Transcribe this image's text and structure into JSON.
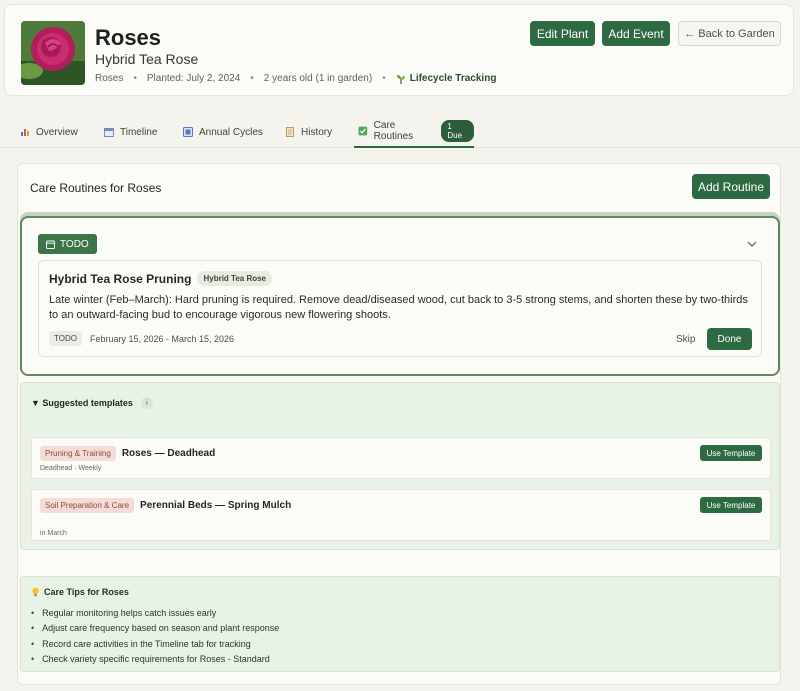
{
  "header": {
    "title": "Roses",
    "subtitle": "Hybrid Tea Rose",
    "meta": {
      "category": "Roses",
      "planted": "Planted: July 2, 2024",
      "age": "2 years old (1 in garden)",
      "lifecycle": "Lifecycle Tracking"
    },
    "buttons": {
      "edit": "Edit Plant",
      "add_event": "Add Event",
      "back": "← Back to Garden"
    }
  },
  "tabs": [
    {
      "label": "Overview",
      "icon": "bar-chart-icon"
    },
    {
      "label": "Timeline",
      "icon": "calendar-icon"
    },
    {
      "label": "Annual Cycles",
      "icon": "cycle-icon"
    },
    {
      "label": "History",
      "icon": "scroll-icon"
    },
    {
      "label": "Care Routines",
      "icon": "checkbox-icon",
      "badge": "1 Due",
      "active": true
    }
  ],
  "routines": {
    "title": "Care Routines for Roses",
    "add_button": "Add Routine",
    "group_label": "TODO",
    "item": {
      "name": "Hybrid Tea Rose Pruning",
      "variety": "Hybrid Tea Rose",
      "description": "Late winter (Feb–March): Hard pruning is required. Remove dead/diseased wood, cut back to 3-5 strong stems, and shorten these by two-thirds to an outward-facing bud to encourage vigorous new flowering shoots.",
      "status": "TODO",
      "dates": "February 15, 2026 - March 15, 2026",
      "skip": "Skip",
      "done": "Done"
    }
  },
  "suggested": {
    "title": "▼ Suggested templates",
    "info_glyph": "i",
    "templates": [
      {
        "category": "Pruning & Training",
        "name": "Roses — Deadhead",
        "sub": "Deadhead · Weekly",
        "button": "Use Template"
      },
      {
        "category": "Soil Preparation & Care",
        "name": "Perennial Beds — Spring Mulch",
        "sub": "in March",
        "button": "Use Template"
      }
    ]
  },
  "tips": {
    "title": "Care Tips for Roses",
    "items": [
      "Regular monitoring helps catch issues early",
      "Adjust care frequency based on season and plant response",
      "Record care activities in the Timeline tab for tracking",
      "Check variety specific requirements for Roses - Standard"
    ]
  },
  "colors": {
    "accent": "#2d6a41",
    "todo": "#3c7648",
    "suggest_bg": "#e9f2e7",
    "category_chip": "#f6dcd8"
  }
}
